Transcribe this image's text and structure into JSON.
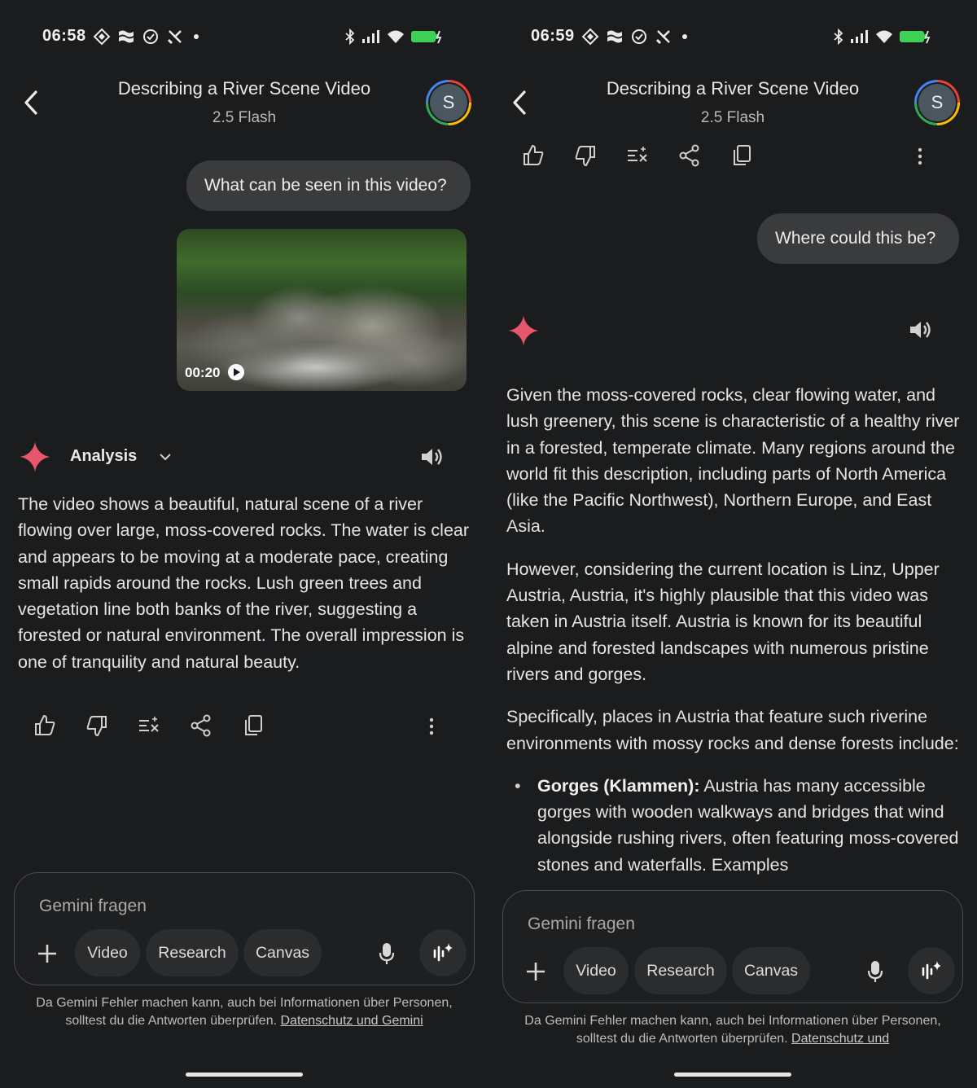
{
  "left": {
    "status": {
      "time": "06:58"
    },
    "header": {
      "title": "Describing a River Scene Video",
      "model": "2.5 Flash",
      "avatar_letter": "S"
    },
    "user_message": "What can be seen in this video?",
    "video": {
      "duration": "00:20"
    },
    "response": {
      "mode_label": "Analysis",
      "text": "The video shows a beautiful, natural scene of a river flowing over large, moss-covered rocks. The water is clear and appears to be moving at a moderate pace, creating small rapids around the rocks. Lush green trees and vegetation line both banks of the river, suggesting a forested or natural environment. The overall impression is one of tranquility and natural beauty."
    },
    "input": {
      "placeholder": "Gemini fragen",
      "chips": [
        "Video",
        "Research",
        "Canvas"
      ]
    },
    "disclaimer": {
      "text": "Da Gemini Fehler machen kann, auch bei Informationen über Personen, solltest du die Antworten überprüfen.",
      "link": "Datenschutz und Gemini"
    }
  },
  "right": {
    "status": {
      "time": "06:59"
    },
    "header": {
      "title": "Describing a River Scene Video",
      "model": "2.5 Flash",
      "avatar_letter": "S"
    },
    "user_message": "Where could this be?",
    "response": {
      "p1": "Given the moss-covered rocks, clear flowing water, and lush greenery, this scene is characteristic of a healthy river in a forested, temperate climate. Many regions around the world fit this description, including parts of North America (like the Pacific Northwest), Northern Europe, and East Asia.",
      "p2": "However, considering the current location is Linz, Upper Austria, Austria, it's highly plausible that this video was taken in Austria itself. Austria is known for its beautiful alpine and forested landscapes with numerous pristine rivers and gorges.",
      "p3": "Specifically, places in Austria that feature such riverine environments with mossy rocks and dense forests include:",
      "bullet_title": "Gorges (Klammen):",
      "bullet_text": "Austria has many accessible gorges with wooden walkways and bridges that wind alongside rushing rivers, often featuring moss-covered stones and waterfalls. Examples"
    },
    "input": {
      "placeholder": "Gemini fragen",
      "chips": [
        "Video",
        "Research",
        "Canvas"
      ]
    },
    "disclaimer": {
      "text": "Da Gemini Fehler machen kann, auch bei Informationen über Personen, solltest du die Antworten überprüfen.",
      "link": "Datenschutz und"
    }
  },
  "colors": {
    "gemini_star": "#e8566b",
    "background": "#1b1c1d",
    "bubble": "#3a3b3d"
  }
}
